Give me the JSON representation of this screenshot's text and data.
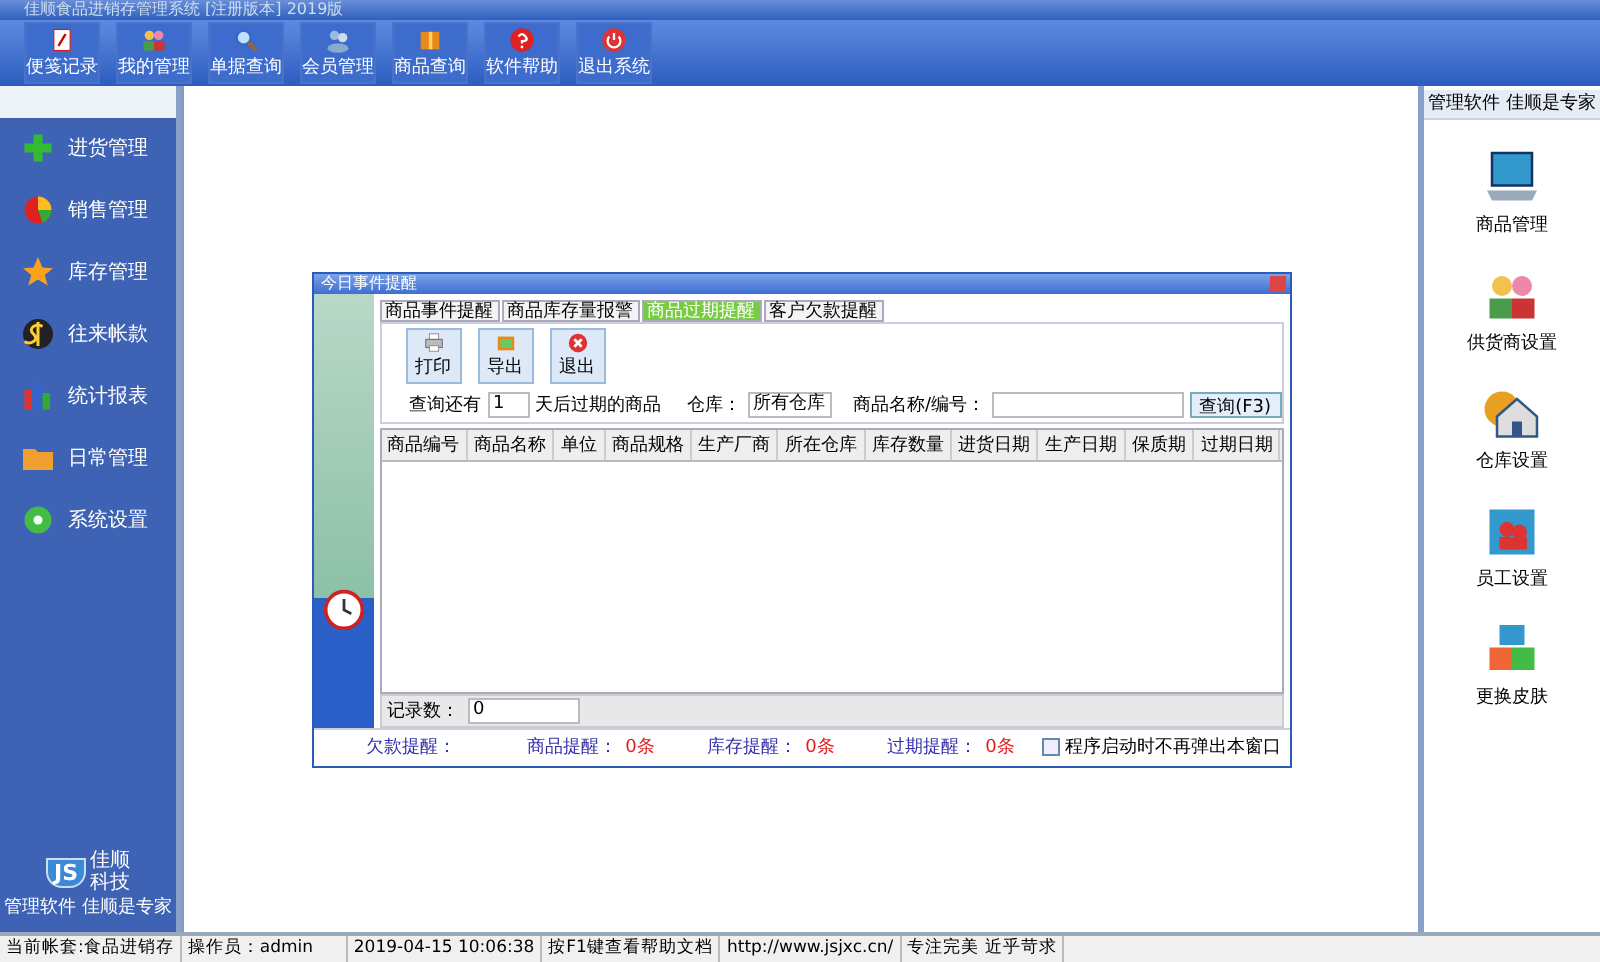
{
  "window": {
    "title": "佳顺食品进销存管理系统 [注册版本] 2019版"
  },
  "toolbar": [
    {
      "label": "便笺记录"
    },
    {
      "label": "我的管理"
    },
    {
      "label": "单据查询"
    },
    {
      "label": "会员管理"
    },
    {
      "label": "商品查询"
    },
    {
      "label": "软件帮助"
    },
    {
      "label": "退出系统"
    }
  ],
  "sidebar": {
    "items": [
      {
        "label": "进货管理"
      },
      {
        "label": "销售管理"
      },
      {
        "label": "库存管理"
      },
      {
        "label": "往来帐款"
      },
      {
        "label": "统计报表"
      },
      {
        "label": "日常管理"
      },
      {
        "label": "系统设置"
      }
    ],
    "logo": {
      "mark": "JS",
      "name_1": "佳顺",
      "name_2": "科技",
      "slogan": "管理软件 佳顺是专家"
    }
  },
  "right_panel": {
    "header": "管理软件 佳顺是专家",
    "items": [
      {
        "label": "商品管理"
      },
      {
        "label": "供货商设置"
      },
      {
        "label": "仓库设置"
      },
      {
        "label": "员工设置"
      },
      {
        "label": "更换皮肤"
      }
    ]
  },
  "dialog": {
    "title": "今日事件提醒",
    "tabs": [
      {
        "label": "商品事件提醒",
        "selected": false
      },
      {
        "label": "商品库存量报警",
        "selected": false
      },
      {
        "label": "商品过期提醒",
        "selected": true
      },
      {
        "label": "客户欠款提醒",
        "selected": false
      }
    ],
    "actions": [
      {
        "label": "打印"
      },
      {
        "label": "导出"
      },
      {
        "label": "退出"
      }
    ],
    "query": {
      "prefix": "查询还有",
      "days": "1",
      "suffix": "天后过期的商品",
      "warehouse_label": "仓库：",
      "warehouse": "所有仓库",
      "name_label": "商品名称/编号：",
      "button": "查询(F3)"
    },
    "table": {
      "columns": [
        "商品编号",
        "商品名称",
        "单位",
        "商品规格",
        "生产厂商",
        "所在仓库",
        "库存数量",
        "进货日期",
        "生产日期",
        "保质期",
        "过期日期"
      ]
    },
    "record": {
      "label": "记录数：",
      "value": "0"
    },
    "footer": [
      {
        "label": "欠款提醒："
      },
      {
        "label": "商品提醒：",
        "count": "0条"
      },
      {
        "label": "库存提醒：",
        "count": "0条"
      },
      {
        "label": "过期提醒：",
        "count": "0条"
      }
    ],
    "dont_show": {
      "label": "程序启动时不再弹出本窗口",
      "checked": false
    }
  },
  "status_bar": [
    "当前帐套:食品进销存",
    "操作员：admin",
    "2019-04-15 10:06:38",
    "按F1键查看帮助文档",
    "http://www.jsjxc.cn/",
    "专注完美 近乎苛求"
  ]
}
